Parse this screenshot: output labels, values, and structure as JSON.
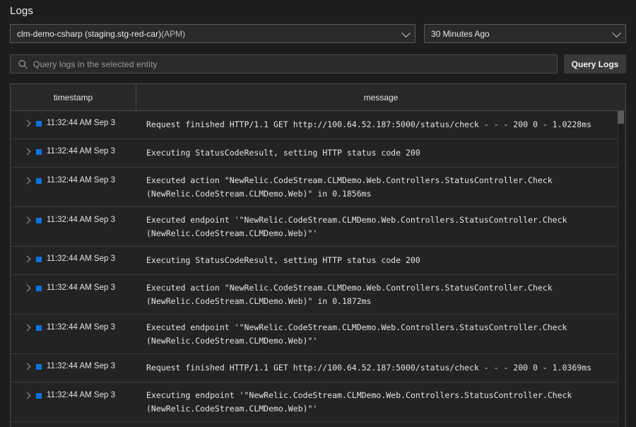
{
  "header": {
    "title": "Logs"
  },
  "colors": {
    "page_background": "#1d1d1d",
    "panel_background": "#232323",
    "accent_level": "#0c74df",
    "border": "#4a4a4a",
    "text_primary": "#e6e6e6",
    "text_muted": "#9a9a9a"
  },
  "controls": {
    "entity_select": {
      "value": "clm-demo-csharp (staging.stg-red-car)",
      "suffix": " (APM)",
      "icon": "chevron-down-icon"
    },
    "time_range_select": {
      "value": "30 Minutes Ago",
      "icon": "chevron-down-icon"
    }
  },
  "query": {
    "icon": "search-icon",
    "value": "",
    "placeholder": "Query logs in the selected entity",
    "button_label": "Query Logs"
  },
  "table": {
    "columns": [
      {
        "key": "timestamp",
        "label": "timestamp"
      },
      {
        "key": "message",
        "label": "message"
      }
    ],
    "rows": [
      {
        "timestamp": "11:32:44 AM Sep 3",
        "level_color": "#0c74df",
        "lines": 1,
        "message": "Request finished HTTP/1.1 GET http://100.64.52.187:5000/status/check - - - 200 0 - 1.0228ms"
      },
      {
        "timestamp": "11:32:44 AM Sep 3",
        "level_color": "#0c74df",
        "lines": 1,
        "message": "Executing StatusCodeResult, setting HTTP status code 200"
      },
      {
        "timestamp": "11:32:44 AM Sep 3",
        "level_color": "#0c74df",
        "lines": 2,
        "message": "Executed action \"NewRelic.CodeStream.CLMDemo.Web.Controllers.StatusController.Check (NewRelic.CodeStream.CLMDemo.Web)\" in 0.1856ms"
      },
      {
        "timestamp": "11:32:44 AM Sep 3",
        "level_color": "#0c74df",
        "lines": 2,
        "message": "Executed endpoint '\"NewRelic.CodeStream.CLMDemo.Web.Controllers.StatusController.Check (NewRelic.CodeStream.CLMDemo.Web)\"'"
      },
      {
        "timestamp": "11:32:44 AM Sep 3",
        "level_color": "#0c74df",
        "lines": 1,
        "message": "Executing StatusCodeResult, setting HTTP status code 200"
      },
      {
        "timestamp": "11:32:44 AM Sep 3",
        "level_color": "#0c74df",
        "lines": 2,
        "message": "Executed action \"NewRelic.CodeStream.CLMDemo.Web.Controllers.StatusController.Check (NewRelic.CodeStream.CLMDemo.Web)\" in 0.1872ms"
      },
      {
        "timestamp": "11:32:44 AM Sep 3",
        "level_color": "#0c74df",
        "lines": 2,
        "message": "Executed endpoint '\"NewRelic.CodeStream.CLMDemo.Web.Controllers.StatusController.Check (NewRelic.CodeStream.CLMDemo.Web)\"'"
      },
      {
        "timestamp": "11:32:44 AM Sep 3",
        "level_color": "#0c74df",
        "lines": 1,
        "message": "Request finished HTTP/1.1 GET http://100.64.52.187:5000/status/check - - - 200 0 - 1.0369ms"
      },
      {
        "timestamp": "11:32:44 AM Sep 3",
        "level_color": "#0c74df",
        "lines": 2,
        "message": "Executing endpoint '\"NewRelic.CodeStream.CLMDemo.Web.Controllers.StatusController.Check (NewRelic.CodeStream.CLMDemo.Web)\"'"
      }
    ]
  },
  "scrollbar": {
    "orientation": "vertical",
    "thumb_position_pct": 0,
    "thumb_size_pct": 4
  }
}
